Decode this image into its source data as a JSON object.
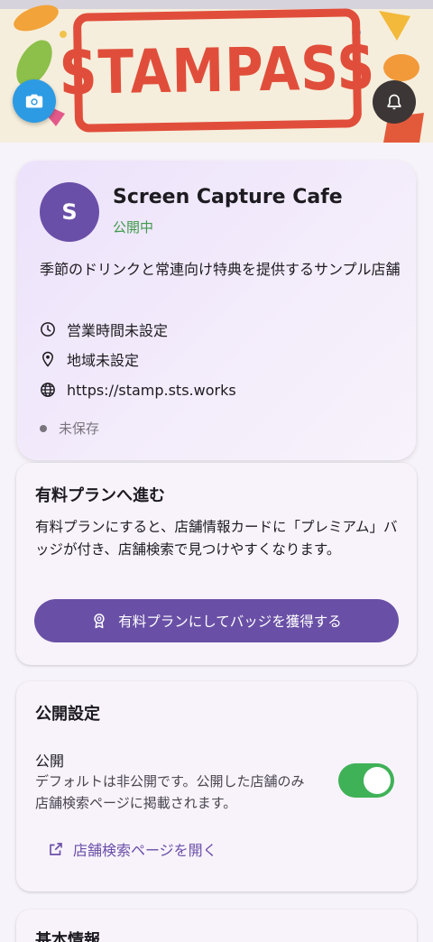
{
  "banner": {
    "logo_text": "STAMPASS",
    "camera_icon": "camera-icon",
    "bell_icon": "bell-icon"
  },
  "profile": {
    "avatar_letter": "S",
    "name": "Screen Capture Cafe",
    "status": "公開中",
    "description": "季節のドリンクと常連向け特典を提供するサンプル店舗",
    "hours": "営業時間未設定",
    "area": "地域未設定",
    "url": "https://stamp.sts.works",
    "save_status": "未保存"
  },
  "plan": {
    "title": "有料プランへ進む",
    "description": "有料プランにすると、店舗情報カードに「プレミアム」バッジが付き、店舗検索で見つけやすくなります。",
    "button_label": "有料プランにしてバッジを獲得する"
  },
  "publish": {
    "title": "公開設定",
    "label": "公開",
    "description": "デフォルトは非公開です。公開した店舗のみ店舗検索ページに掲載されます。",
    "enabled": true,
    "link_label": "店舗検索ページを開く"
  },
  "basic": {
    "title": "基本情報"
  },
  "colors": {
    "primary": "#6950a6",
    "toggle_on": "#3fb157",
    "status_green": "#3e9a4a",
    "stamp_red": "#e04e3b"
  }
}
